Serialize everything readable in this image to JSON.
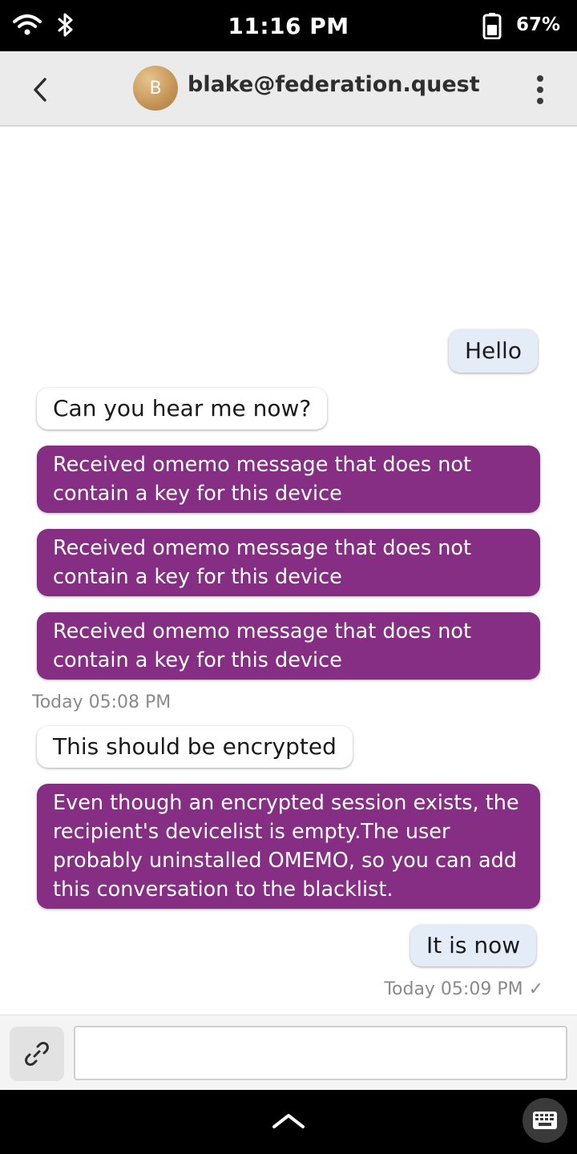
{
  "status_bar": {
    "time": "11:16 PM",
    "battery_percent": "67%",
    "icons": [
      "wifi-icon",
      "bluetooth-icon",
      "battery-icon"
    ]
  },
  "header": {
    "avatar_initial": "B",
    "contact": "blake@federation.quest",
    "icons": [
      "back-icon",
      "more-vertical-icon"
    ]
  },
  "messages": {
    "m1": "Hello",
    "m2": "Can you hear me now?",
    "m3_line1": "Received omemo message that does not",
    "m3_line2": "contain a key for this device",
    "m4_line1": "Received omemo message that does not",
    "m4_line2": "contain a key for this device",
    "m5_line1": "Received omemo message that does not",
    "m5_line2": "contain a key for this device",
    "stamp1": "Today 05:08 PM",
    "m6": "This should be encrypted",
    "m7_line1": "Even though an encrypted session exists, the",
    "m7_line2": "recipient's devicelist is empty.The user",
    "m7_line3": "probably uninstalled OMEMO, so you can add",
    "m7_line4": "this conversation to the blacklist.",
    "m8": "It is now",
    "stamp2": "Today 05:09 PM ✓"
  },
  "composer": {
    "placeholder": "",
    "value": "",
    "attach_icon": "attach-link-icon"
  },
  "navbar": {
    "icons": [
      "chevron-up-icon",
      "keyboard-icon"
    ]
  },
  "colors": {
    "error_bubble": "#862d84",
    "outgoing_bubble": "#e3ecf7",
    "header_bg": "#ebebeb"
  }
}
